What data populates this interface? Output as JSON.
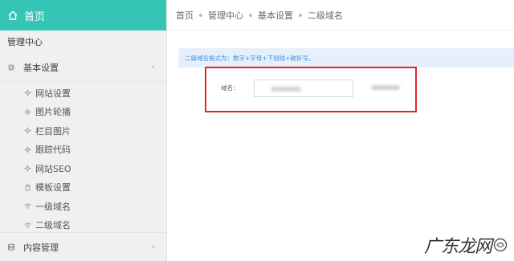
{
  "sidebar": {
    "home_label": "首页",
    "section_title": "管理中心",
    "basic_settings": {
      "label": "基本设置",
      "items": [
        {
          "label": "网站设置",
          "icon": "gear-icon"
        },
        {
          "label": "图片轮播",
          "icon": "gear-icon"
        },
        {
          "label": "栏目图片",
          "icon": "gear-icon"
        },
        {
          "label": "跟踪代码",
          "icon": "gear-icon"
        },
        {
          "label": "网站SEO",
          "icon": "gear-icon"
        },
        {
          "label": "模板设置",
          "icon": "trash-icon"
        },
        {
          "label": "一级域名",
          "icon": "wifi-icon"
        },
        {
          "label": "二级域名",
          "icon": "wifi-icon"
        }
      ]
    },
    "content_mgmt": {
      "label": "内容管理"
    }
  },
  "breadcrumb": [
    "首页",
    "管理中心",
    "基本设置",
    "二级域名"
  ],
  "info_text": "二级域名格式为：数字+字母+下划线+破折号。",
  "form": {
    "domain_label": "域名："
  },
  "watermark": "广东龙网",
  "colors": {
    "accent": "#35c5b5",
    "info_bg": "#e6f0fb",
    "info_text": "#3a8ee0",
    "highlight": "#e0262b"
  }
}
